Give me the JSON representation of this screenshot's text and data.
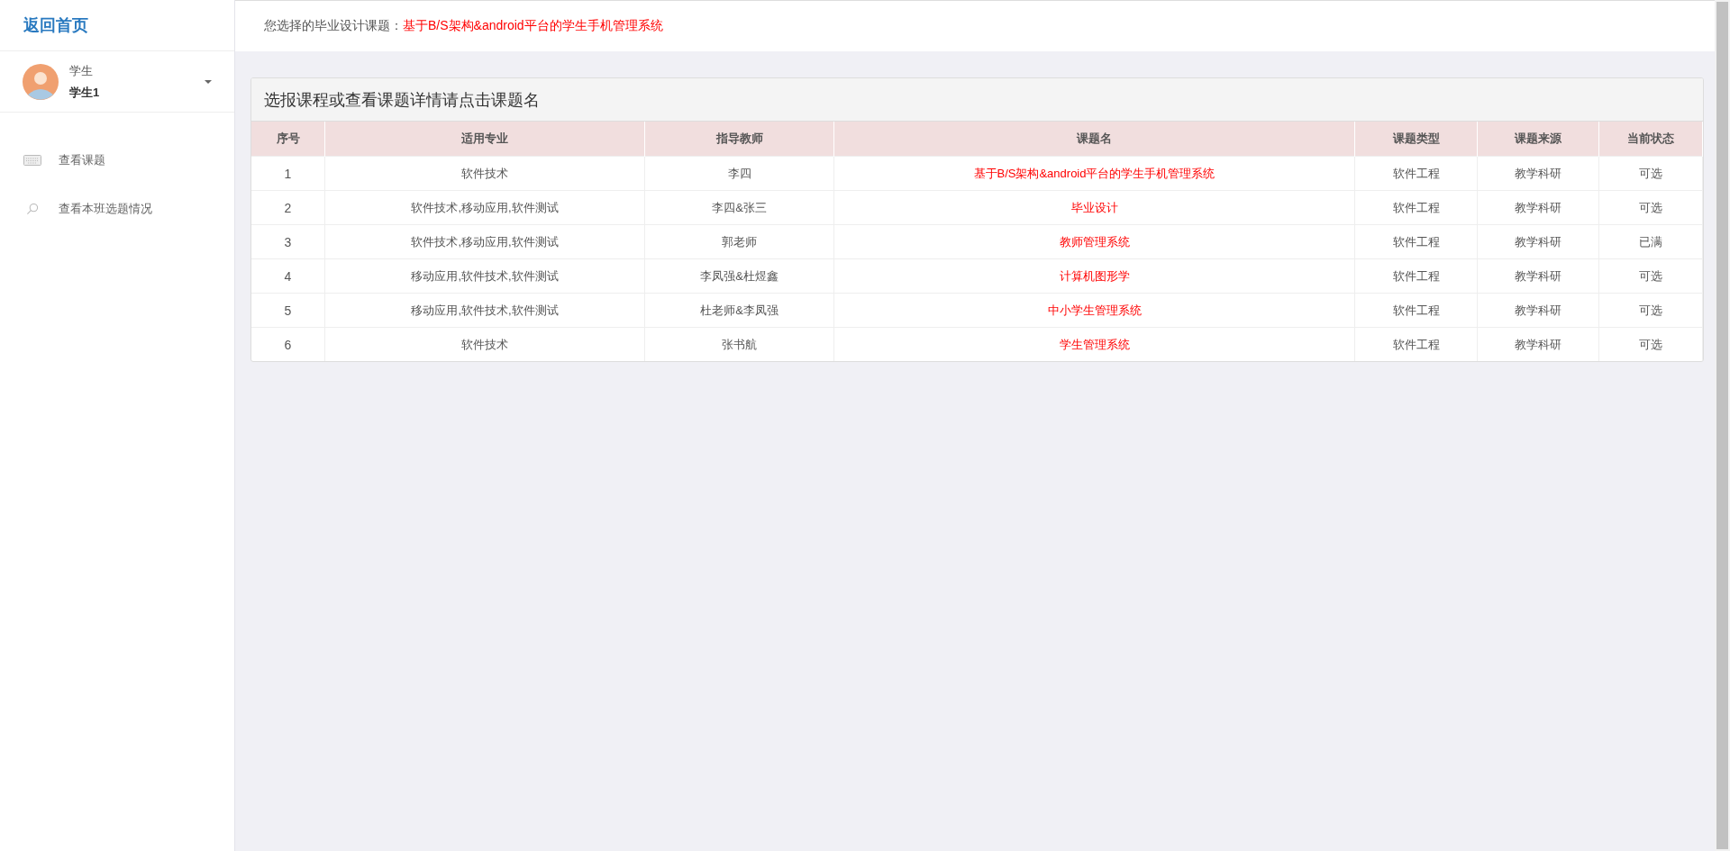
{
  "sidebar": {
    "home_link": "返回首页",
    "user": {
      "role": "学生",
      "name": "学生1"
    },
    "menu": [
      {
        "label": "查看课题",
        "kind": "keyboard"
      },
      {
        "label": "查看本班选题情况",
        "kind": "search"
      }
    ]
  },
  "header": {
    "label": "您选择的毕业设计课题：",
    "topic": "基于B/S架构&android平台的学生手机管理系统"
  },
  "panel": {
    "title": "选报课程或查看课题详情请点击课题名",
    "table": {
      "columns": [
        "序号",
        "适用专业",
        "指导教师",
        "课题名",
        "课题类型",
        "课题来源",
        "当前状态"
      ],
      "rows": [
        {
          "no": "1",
          "major": "软件技术",
          "teacher": "李四",
          "title": "基于B/S架构&android平台的学生手机管理系统",
          "type": "软件工程",
          "source": "教学科研",
          "status": "可选"
        },
        {
          "no": "2",
          "major": "软件技术,移动应用,软件测试",
          "teacher": "李四&张三",
          "title": "毕业设计",
          "type": "软件工程",
          "source": "教学科研",
          "status": "可选"
        },
        {
          "no": "3",
          "major": "软件技术,移动应用,软件测试",
          "teacher": "郭老师",
          "title": "教师管理系统",
          "type": "软件工程",
          "source": "教学科研",
          "status": "已满"
        },
        {
          "no": "4",
          "major": "移动应用,软件技术,软件测试",
          "teacher": "李凤强&杜煜鑫",
          "title": "计算机图形学",
          "type": "软件工程",
          "source": "教学科研",
          "status": "可选"
        },
        {
          "no": "5",
          "major": "移动应用,软件技术,软件测试",
          "teacher": "杜老师&李凤强",
          "title": "中小学生管理系统",
          "type": "软件工程",
          "source": "教学科研",
          "status": "可选"
        },
        {
          "no": "6",
          "major": "软件技术",
          "teacher": "张书航",
          "title": "学生管理系统",
          "type": "软件工程",
          "source": "教学科研",
          "status": "可选"
        }
      ]
    }
  }
}
